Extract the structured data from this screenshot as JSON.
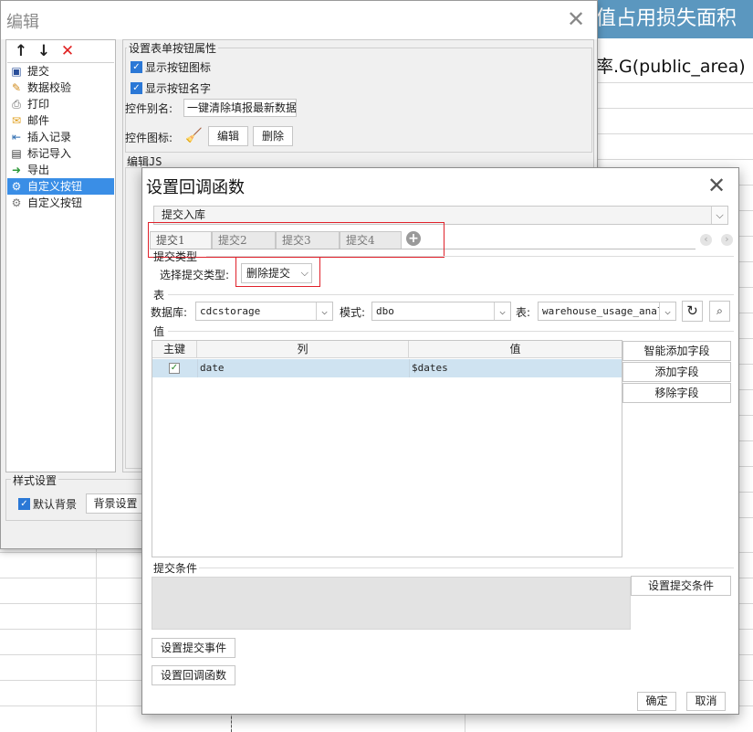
{
  "background": {
    "header_text": "值占用损失面积",
    "subheader_text": "率.G(public_area)",
    "header_color": "#5b97bf"
  },
  "edit_dialog": {
    "title": "编辑",
    "close_glyph": "✕",
    "toolbar": [
      {
        "icon": "arrow-up-icon",
        "glyph": "↑"
      },
      {
        "icon": "arrow-down-icon",
        "glyph": "↓"
      },
      {
        "icon": "delete-icon",
        "glyph": "✕"
      }
    ],
    "list_items": [
      {
        "label": "提交",
        "icon": "save-icon"
      },
      {
        "label": "数据校验",
        "icon": "pencil-icon"
      },
      {
        "label": "打印",
        "icon": "printer-icon"
      },
      {
        "label": "邮件",
        "icon": "mail-icon"
      },
      {
        "label": "插入记录",
        "icon": "insert-record-icon"
      },
      {
        "label": "标记导入",
        "icon": "import-icon"
      },
      {
        "label": "导出",
        "icon": "export-icon"
      },
      {
        "label": "自定义按钮",
        "icon": "gear-icon",
        "selected": true
      },
      {
        "label": "自定义按钮",
        "icon": "gear-icon"
      }
    ],
    "props_group_title": "设置表单按钮属性",
    "show_icon_label": "显示按钮图标",
    "show_name_label": "显示按钮名字",
    "alias_label": "控件别名:",
    "alias_value": "一键清除填报最新数据",
    "icon_label": "控件图标:",
    "edit_button": "编辑",
    "delete_button": "删除",
    "edit_js_label": "编辑JS",
    "style_group_title": "样式设置",
    "default_bg_label": "默认背景",
    "bg_settings_button": "背景设置"
  },
  "callback_dialog": {
    "title": "设置回调函数",
    "close_glyph": "✕",
    "submit_type_select": "提交入库",
    "tabs": [
      "提交1",
      "提交2",
      "提交3",
      "提交4"
    ],
    "add_tab_glyph": "+",
    "nav_prev": "‹",
    "nav_next": "›",
    "submit_type_section": "提交类型",
    "select_submit_type_label": "选择提交类型:",
    "submit_type_value": "删除提交",
    "table_section": "表",
    "database_label": "数据库:",
    "database_value": "cdcstorage",
    "schema_label": "模式:",
    "schema_value": "dbo",
    "table_label": "表:",
    "table_value": "warehouse_usage_analy",
    "values_section": "值",
    "grid_headers": [
      "主键",
      "列",
      "值"
    ],
    "grid_rows": [
      {
        "pk": true,
        "column": "date",
        "value": "$dates"
      }
    ],
    "smart_add_button": "智能添加字段",
    "add_field_button": "添加字段",
    "remove_field_button": "移除字段",
    "conditions_section": "提交条件",
    "set_conditions_button": "设置提交条件",
    "set_submit_event_button": "设置提交事件",
    "set_callback_button": "设置回调函数",
    "ok_button": "确定",
    "cancel_button": "取消",
    "highlight_color": "#e0212b"
  }
}
